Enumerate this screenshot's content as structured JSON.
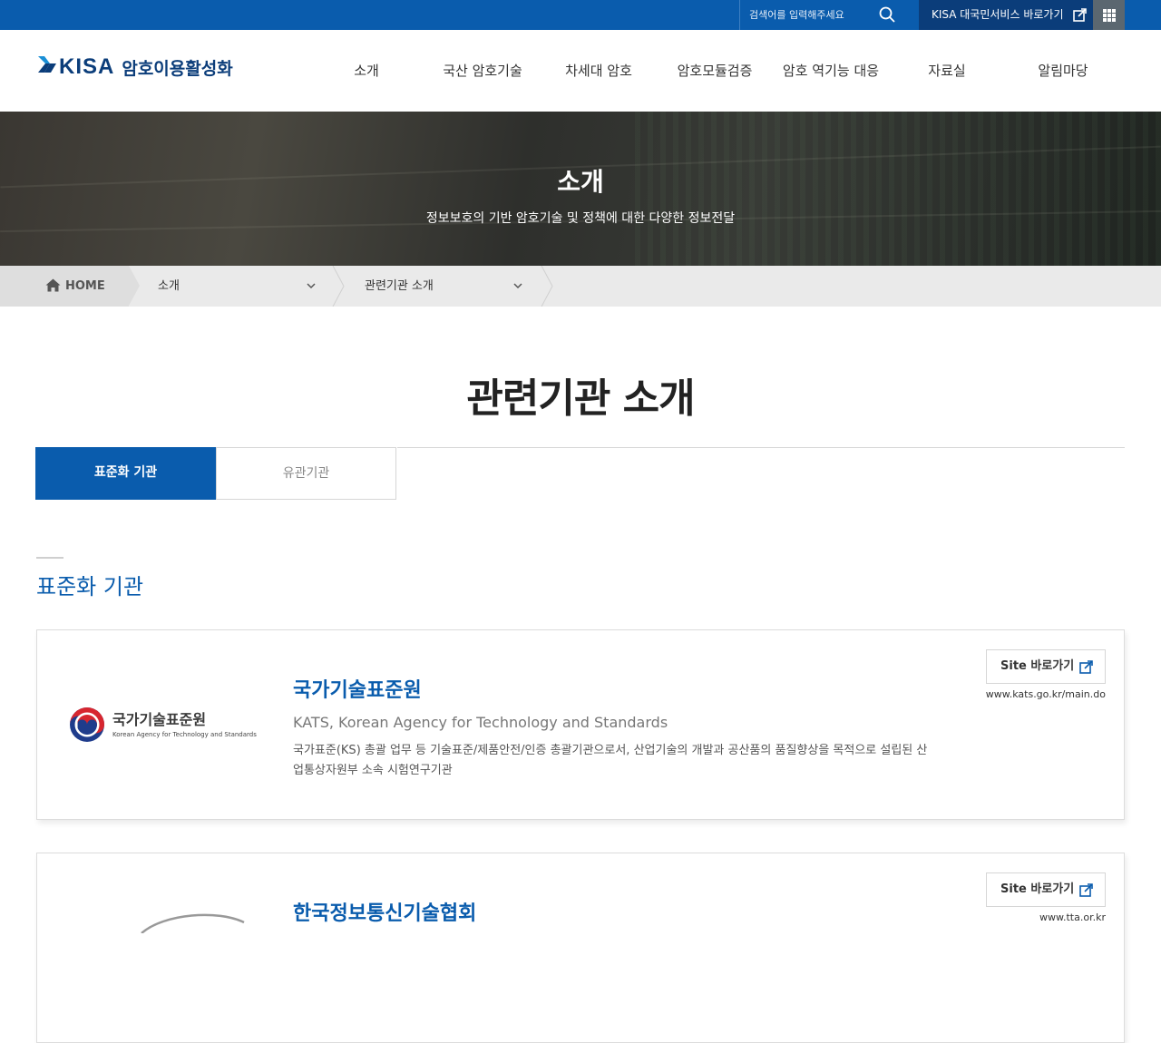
{
  "topbar": {
    "search_placeholder": "검색어를 입력해주세요",
    "kisa_link_label": "KISA 대국민서비스 바로가기"
  },
  "header": {
    "logo_kisa": "KISA",
    "logo_sub": "암호이용활성화",
    "nav": [
      "소개",
      "국산 암호기술",
      "차세대 암호",
      "암호모듈검증",
      "암호 역기능 대응",
      "자료실",
      "알림마당"
    ]
  },
  "hero": {
    "title": "소개",
    "subtitle": "정보보호의 기반 암호기술 및 정책에 대한 다양한 정보전달"
  },
  "breadcrumb": {
    "home": "HOME",
    "level1": "소개",
    "level2": "관련기관 소개"
  },
  "page": {
    "title": "관련기관 소개",
    "tabs": [
      {
        "label": "표준화 기관",
        "active": true
      },
      {
        "label": "유관기관",
        "active": false
      }
    ],
    "section_title": "표준화 기관"
  },
  "orgs": [
    {
      "name": "국가기술표준원",
      "name_en": "KATS, Korean Agency for Technology and Standards",
      "desc": "국가표준(KS) 총괄 업무 등 기술표준/제품안전/인증 총괄기관으로서, 산업기술의 개발과 공산품의 품질향상을 목적으로 설립된 산업통상자원부 소속 시험연구기관",
      "logo_ko": "국가기술표준원",
      "logo_en": "Korean Agency for Technology and Standards",
      "site_label": "Site 바로가기",
      "url": "www.kats.go.kr/main.do"
    },
    {
      "name": "한국정보통신기술협회",
      "site_label": "Site 바로가기",
      "url": "www.tta.or.kr"
    }
  ],
  "colors": {
    "primary": "#0a5cad",
    "navy": "#0b3d7a",
    "grid_button": "#5b6770"
  }
}
